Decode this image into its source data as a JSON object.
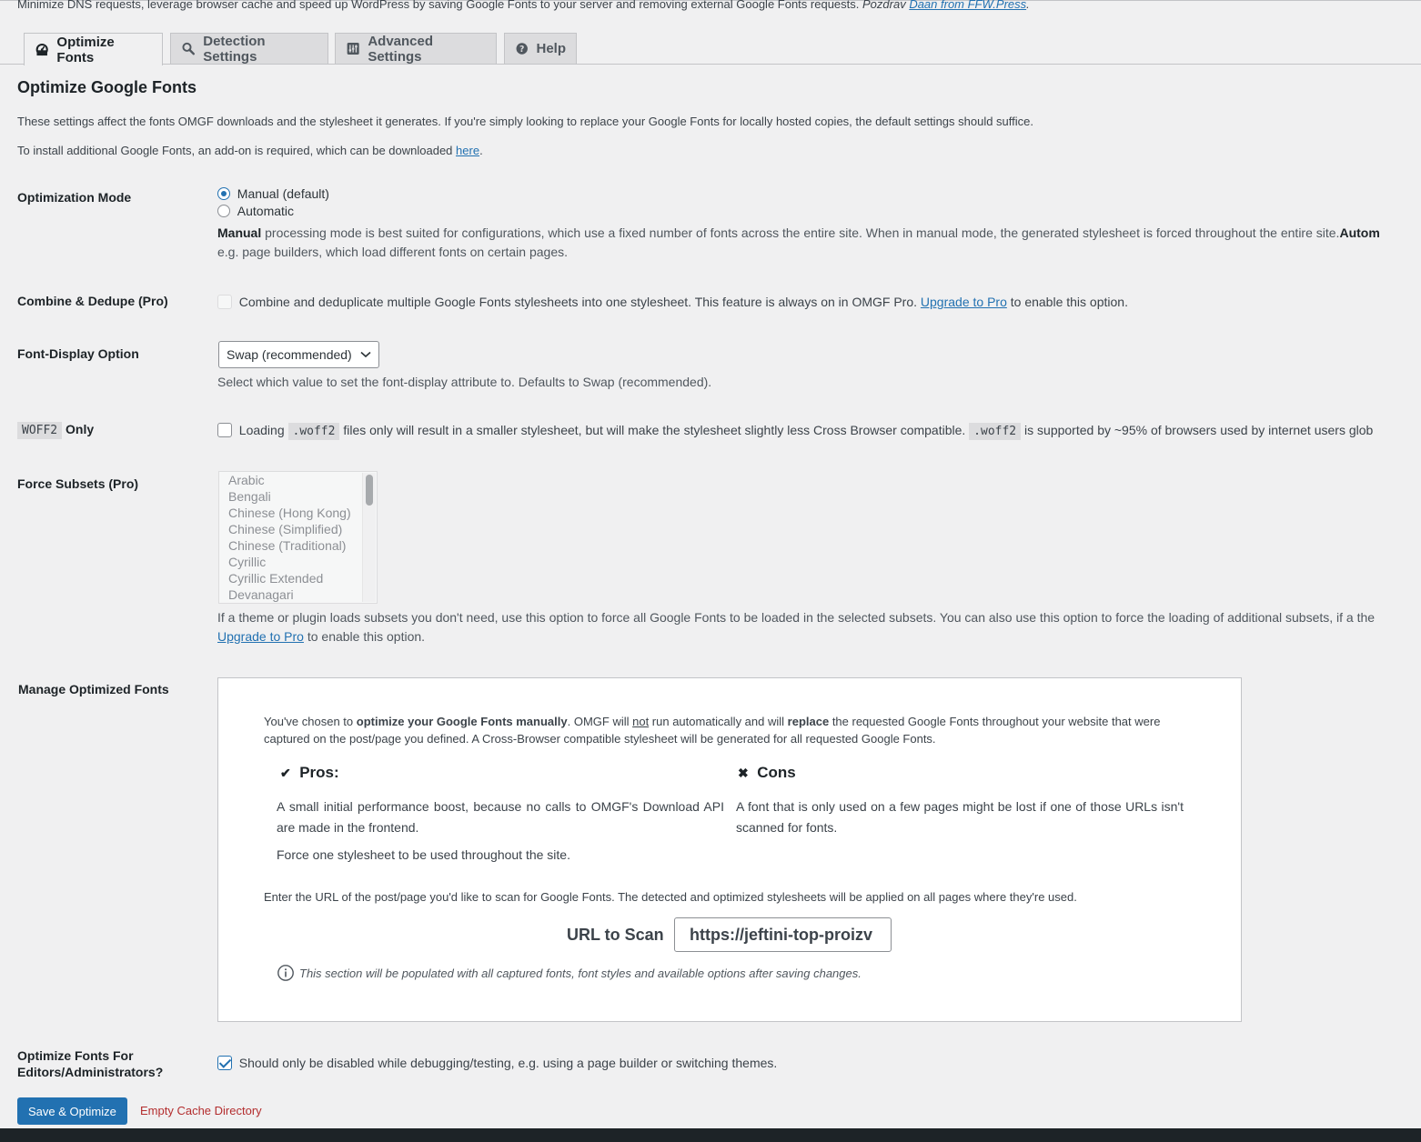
{
  "intro": {
    "text": "Minimize DNS requests, leverage browser cache and speed up WordPress by saving Google Fonts to your server and removing external Google Fonts requests. ",
    "credit_prefix": "Pozdrav ",
    "credit_link": "Daan from FFW.Press",
    "credit_suffix": "."
  },
  "tabs": [
    {
      "label": "Optimize Fonts",
      "icon": "dashboard-icon"
    },
    {
      "label": "Detection Settings",
      "icon": "search-icon"
    },
    {
      "label": "Advanced Settings",
      "icon": "settings-panel-icon"
    },
    {
      "label": "Help",
      "icon": "help-icon"
    }
  ],
  "section": {
    "title": "Optimize Google Fonts",
    "p1": "These settings affect the fonts OMGF downloads and the stylesheet it generates. If you're simply looking to replace your Google Fonts for locally hosted copies, the default settings should suffice.",
    "p2_prefix": "To install additional Google Fonts, an add-on is required, which can be downloaded ",
    "p2_link": "here",
    "p2_suffix": "."
  },
  "optimization_mode": {
    "label": "Optimization Mode",
    "options": [
      "Manual (default)",
      "Automatic"
    ],
    "selected": "Manual (default)",
    "desc_bold": "Manual",
    "desc_line1": " processing mode is best suited for configurations, which use a fixed number of fonts across the entire site. When in manual mode, the generated stylesheet is forced throughout the entire site.",
    "desc_bold2": "Autom",
    "desc_line2": "e.g. page builders, which load different fonts on certain pages."
  },
  "combine": {
    "label": "Combine & Dedupe (Pro)",
    "text": "Combine and deduplicate multiple Google Fonts stylesheets into one stylesheet. This feature is always on in OMGF Pro. ",
    "link": "Upgrade to Pro",
    "suffix": " to enable this option."
  },
  "font_display": {
    "label": "Font-Display Option",
    "value": "Swap (recommended)",
    "desc": "Select which value to set the font-display attribute to. Defaults to Swap (recommended)."
  },
  "woff2": {
    "label_code": "WOFF2",
    "label_suffix": " Only",
    "text1": "Loading ",
    "code1": ".woff2",
    "text2": " files only will result in a smaller stylesheet, but will make the stylesheet slightly less Cross Browser compatible. ",
    "code2": ".woff2",
    "text3": " is supported by ~95% of browsers used by internet users glob",
    "checked": false
  },
  "force_subsets": {
    "label": "Force Subsets (Pro)",
    "options": [
      "Arabic",
      "Bengali",
      "Chinese (Hong Kong)",
      "Chinese (Simplified)",
      "Chinese (Traditional)",
      "Cyrillic",
      "Cyrillic Extended",
      "Devanagari"
    ],
    "desc_line1": "If a theme or plugin loads subsets you don't need, use this option to force all Google Fonts to be loaded in the selected subsets. You can also use this option to force the loading of additional subsets, if a the",
    "link": "Upgrade to Pro",
    "suffix": " to enable this option."
  },
  "manage": {
    "label": "Manage Optimized Fonts",
    "intro_1": "You've chosen to ",
    "intro_b1": "optimize your Google Fonts manually",
    "intro_2": ". OMGF will ",
    "intro_u": "not",
    "intro_3": " run automatically and will ",
    "intro_b2": "replace",
    "intro_4": " the requested Google Fonts throughout your website that were",
    "intro_line2": "captured on the post/page you defined. A Cross-Browser compatible stylesheet will be generated for all requested Google Fonts.",
    "pros_title": "Pros:",
    "pros_mark": "✔",
    "cons_title": "Cons",
    "cons_mark": "✖",
    "pros": [
      "A small initial performance boost, because no calls to OMGF's Download API are made in the frontend.",
      "Force one stylesheet to be used throughout the site."
    ],
    "cons": [
      "A font that is only used on a few pages might be lost if one of those URLs isn't scanned for fonts."
    ],
    "scan_instructions": "Enter the URL of the post/page you'd like to scan for Google Fonts. The detected and optimized stylesheets will be applied on all pages where they're used.",
    "url_label": "URL to Scan",
    "url_value": "https://jeftini-top-proizv",
    "note": "This section will be populated with all captured fonts, font styles and available options after saving changes."
  },
  "editors": {
    "label_line1": "Optimize Fonts For",
    "label_line2": "Editors/Administrators?",
    "text": "Should only be disabled while debugging/testing, e.g. using a page builder or switching themes.",
    "checked": true
  },
  "actions": {
    "save": "Save & Optimize",
    "empty_cache": "Empty Cache Directory"
  },
  "colors": {
    "accent": "#2271b1",
    "danger": "#b32d2e",
    "background": "#f0f0f1"
  }
}
